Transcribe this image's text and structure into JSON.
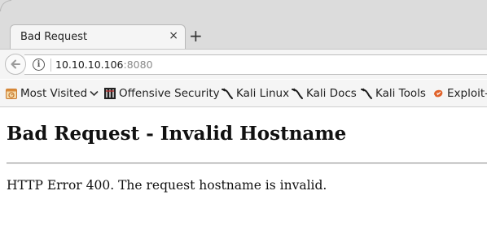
{
  "browser": {
    "tab": {
      "title": "Bad Request",
      "close_glyph": "×"
    },
    "new_tab_glyph": "+",
    "url": {
      "host": "10.10.10.106",
      "port": ":8080"
    }
  },
  "bookmarks": [
    {
      "label": "Most Visited",
      "icon": "most-visited-icon",
      "has_dropdown": true
    },
    {
      "label": "Offensive Security",
      "icon": "offsec-icon"
    },
    {
      "label": "Kali Linux",
      "icon": "kali-dragon-icon"
    },
    {
      "label": "Kali Docs",
      "icon": "kali-dragon-icon"
    },
    {
      "label": "Kali Tools",
      "icon": "kali-dragon-icon"
    },
    {
      "label": "Exploit-",
      "icon": "exploit-db-icon"
    }
  ],
  "page": {
    "heading": "Bad Request - Invalid Hostname",
    "message": "HTTP Error 400. The request hostname is invalid."
  },
  "colors": {
    "chrome_bg": "#dcdcdc",
    "toolbar_bg": "#f5f5f5",
    "exploit_icon": "#e0622a"
  }
}
